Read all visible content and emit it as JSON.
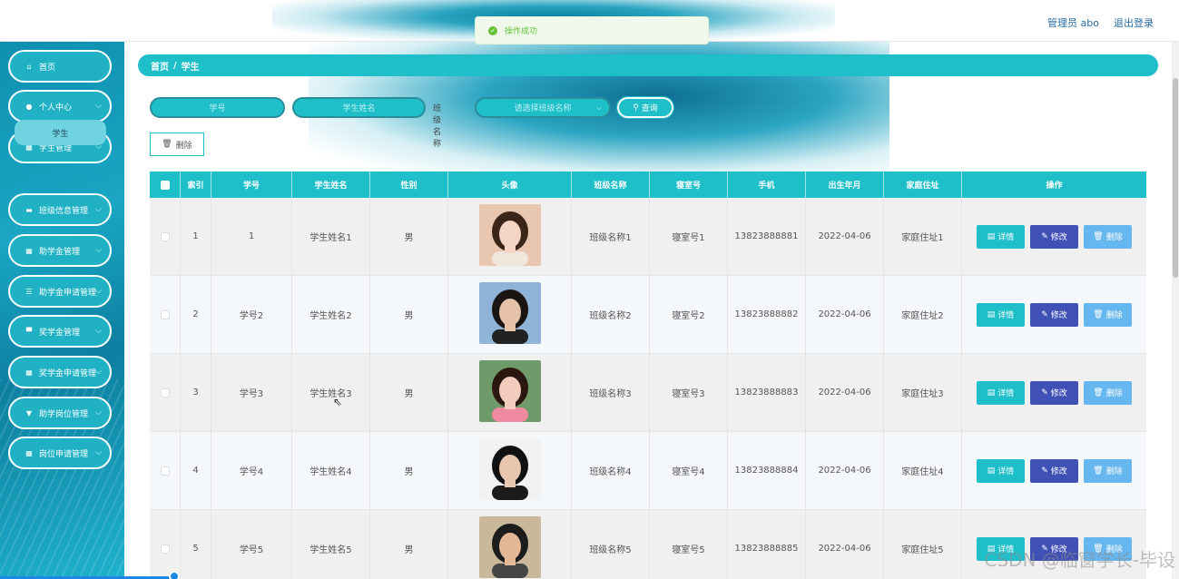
{
  "topbar": {
    "admin": "管理员 abo",
    "logout": "退出登录"
  },
  "toast": {
    "text": "操作成功"
  },
  "sidebar": {
    "items": [
      {
        "label": "首页",
        "icon": "home-icon",
        "glyph": "⌂",
        "chev": false
      },
      {
        "label": "个人中心",
        "icon": "user-icon",
        "glyph": "●",
        "chev": true
      },
      {
        "label": "学生管理",
        "icon": "grid-icon",
        "glyph": "▦",
        "chev": true
      },
      {
        "label": "班级信息管理",
        "icon": "bank-icon",
        "glyph": "▬",
        "chev": true
      },
      {
        "label": "助学金管理",
        "icon": "grid-icon",
        "glyph": "▦",
        "chev": true
      },
      {
        "label": "助学金申请管理",
        "icon": "list-icon",
        "glyph": "☰",
        "chev": true
      },
      {
        "label": "奖学金管理",
        "icon": "monitor-icon",
        "glyph": "▀",
        "chev": true
      },
      {
        "label": "奖学金申请管理",
        "icon": "grid-icon",
        "glyph": "▦",
        "chev": true
      },
      {
        "label": "助学岗位管理",
        "icon": "tag-icon",
        "glyph": "▼",
        "chev": true
      },
      {
        "label": "岗位申请管理",
        "icon": "grid-icon",
        "glyph": "▦",
        "chev": true
      }
    ],
    "submenu": {
      "label": "学生"
    }
  },
  "breadcrumb": {
    "home": "首页",
    "sep": "/",
    "current": "学生"
  },
  "search": {
    "student_no_placeholder": "学号",
    "student_name_placeholder": "学生姓名",
    "class_label": "班级名称",
    "class_placeholder": "请选择班级名称",
    "query_label": "查询"
  },
  "toolbar": {
    "delete_label": "删除"
  },
  "table": {
    "headers": [
      "索引",
      "学号",
      "学生姓名",
      "性别",
      "头像",
      "班级名称",
      "寝室号",
      "手机",
      "出生年月",
      "家庭住址",
      "操作"
    ],
    "rows": [
      {
        "idx": "1",
        "no": "1",
        "name": "学生姓名1",
        "sex": "男",
        "cls": "班级名称1",
        "room": "寝室号1",
        "phone": "13823888881",
        "birth": "2022-04-06",
        "addr": "家庭住址1"
      },
      {
        "idx": "2",
        "no": "学号2",
        "name": "学生姓名2",
        "sex": "男",
        "cls": "班级名称2",
        "room": "寝室号2",
        "phone": "13823888882",
        "birth": "2022-04-06",
        "addr": "家庭住址2"
      },
      {
        "idx": "3",
        "no": "学号3",
        "name": "学生姓名3",
        "sex": "男",
        "cls": "班级名称3",
        "room": "寝室号3",
        "phone": "13823888883",
        "birth": "2022-04-06",
        "addr": "家庭住址3"
      },
      {
        "idx": "4",
        "no": "学号4",
        "name": "学生姓名4",
        "sex": "男",
        "cls": "班级名称4",
        "room": "寝室号4",
        "phone": "13823888884",
        "birth": "2022-04-06",
        "addr": "家庭住址4"
      },
      {
        "idx": "5",
        "no": "学号5",
        "name": "学生姓名5",
        "sex": "男",
        "cls": "班级名称5",
        "room": "寝室号5",
        "phone": "13823888885",
        "birth": "2022-04-06",
        "addr": "家庭住址5"
      }
    ],
    "ops": {
      "detail": "详情",
      "edit": "修改",
      "delete": "删除"
    }
  },
  "watermark": "CSDN @临窗学长-毕设"
}
